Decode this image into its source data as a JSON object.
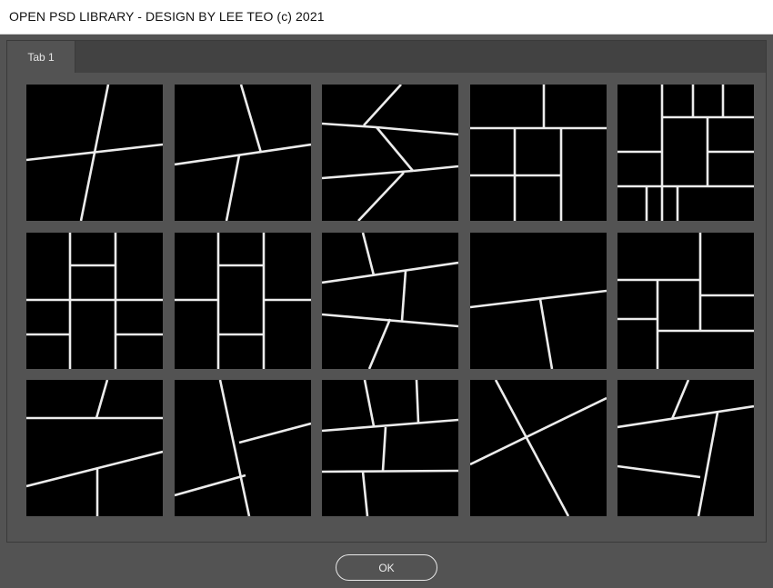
{
  "window": {
    "title": "OPEN PSD LIBRARY - DESIGN BY LEE TEO (c) 2021"
  },
  "tabs": [
    {
      "label": "Tab 1",
      "active": true
    }
  ],
  "thumbnails": [
    {
      "name": "layout-1"
    },
    {
      "name": "layout-2"
    },
    {
      "name": "layout-3"
    },
    {
      "name": "layout-4"
    },
    {
      "name": "layout-5"
    },
    {
      "name": "layout-6"
    },
    {
      "name": "layout-7"
    },
    {
      "name": "layout-8"
    },
    {
      "name": "layout-9"
    },
    {
      "name": "layout-10"
    },
    {
      "name": "layout-11"
    },
    {
      "name": "layout-12"
    },
    {
      "name": "layout-13"
    },
    {
      "name": "layout-14"
    },
    {
      "name": "layout-15"
    }
  ],
  "footer": {
    "ok_label": "OK"
  },
  "colors": {
    "background": "#535353",
    "panel": "#424242",
    "thumbnail_bg": "#000000",
    "divider_line": "#ececec",
    "titlebar": "#ffffff"
  }
}
